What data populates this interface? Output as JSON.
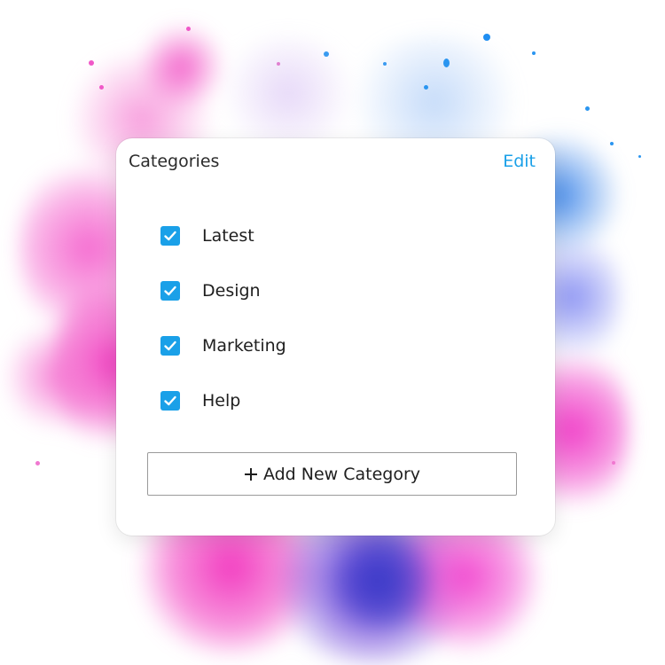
{
  "panel": {
    "title": "Categories",
    "edit_label": "Edit"
  },
  "categories": [
    {
      "label": "Latest",
      "checked": true
    },
    {
      "label": "Design",
      "checked": true
    },
    {
      "label": "Marketing",
      "checked": true
    },
    {
      "label": "Help",
      "checked": true
    }
  ],
  "add_button": {
    "label": "Add New Category",
    "icon": "plus-icon"
  },
  "colors": {
    "accent": "#1aa0e8",
    "text": "#1e1e1e",
    "ink_pink": "#f23fc0",
    "ink_purple": "#7a4fe0",
    "ink_blue": "#2f8af0"
  }
}
